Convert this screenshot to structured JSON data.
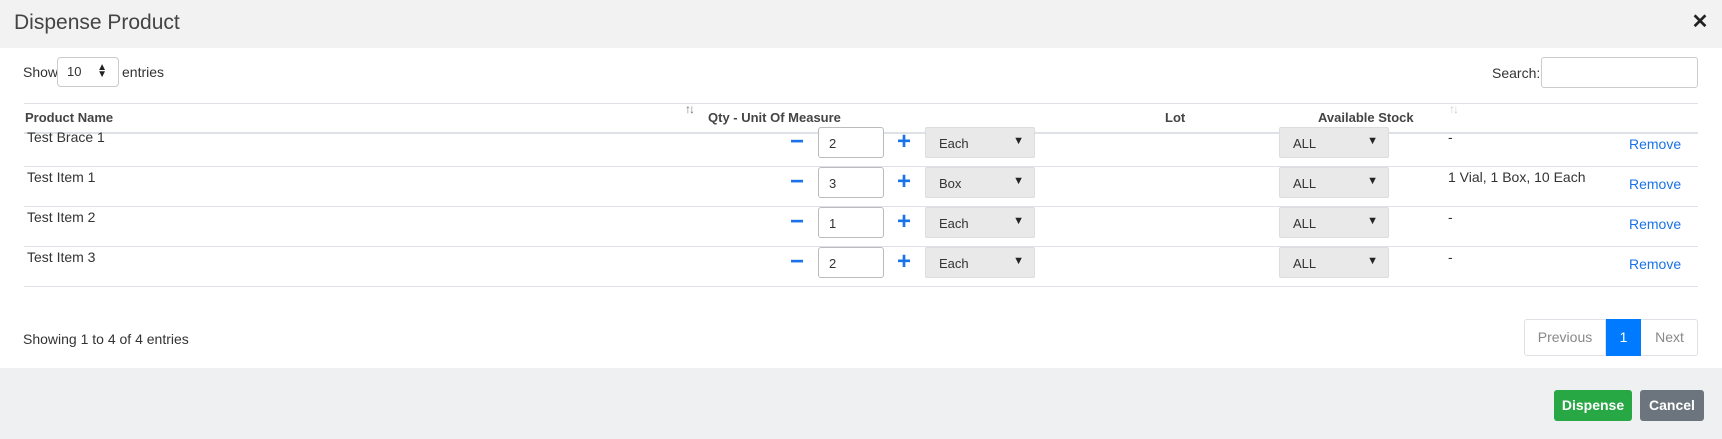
{
  "modal": {
    "title": "Dispense Product",
    "close_glyph": "✕"
  },
  "length_control": {
    "show_label": "Show",
    "selected": "10",
    "entries_label": "entries"
  },
  "search": {
    "label": "Search:",
    "value": ""
  },
  "table": {
    "columns": [
      "Product Name",
      "Qty - Unit Of Measure",
      "Lot",
      "Available Stock"
    ],
    "rows": [
      {
        "name": "Test Brace 1",
        "qty": "2",
        "uom": "Each",
        "lot": "ALL",
        "stock": "-",
        "action": "Remove"
      },
      {
        "name": "Test Item 1",
        "qty": "3",
        "uom": "Box",
        "lot": "ALL",
        "stock": "1 Vial, 1 Box, 10 Each",
        "action": "Remove"
      },
      {
        "name": "Test Item 2",
        "qty": "1",
        "uom": "Each",
        "lot": "ALL",
        "stock": "-",
        "action": "Remove"
      },
      {
        "name": "Test Item 3",
        "qty": "2",
        "uom": "Each",
        "lot": "ALL",
        "stock": "-",
        "action": "Remove"
      }
    ]
  },
  "footer": {
    "info": "Showing 1 to 4 of 4 entries",
    "pagination": {
      "previous": "Previous",
      "current_page": "1",
      "next": "Next"
    }
  },
  "actions": {
    "dispense": "Dispense",
    "cancel": "Cancel"
  },
  "colors": {
    "accent": "#007bff",
    "link": "#1a73e8",
    "dispense": "#28a745",
    "cancel": "#6c757d"
  }
}
